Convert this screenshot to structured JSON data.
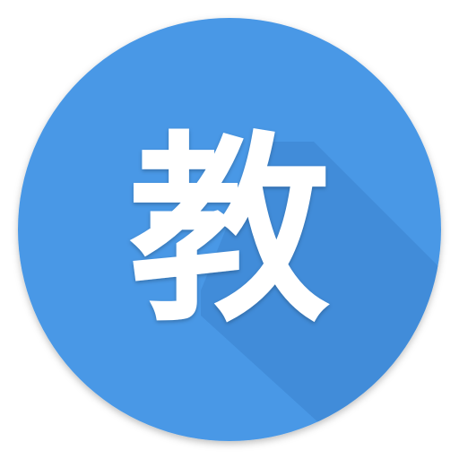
{
  "icon": {
    "glyph": "教",
    "colors": {
      "circle": "#4a98e6",
      "circle_edge": "#3f8ad6",
      "long_shadow": "#2f6fb8",
      "glyph": "#ffffff"
    }
  }
}
